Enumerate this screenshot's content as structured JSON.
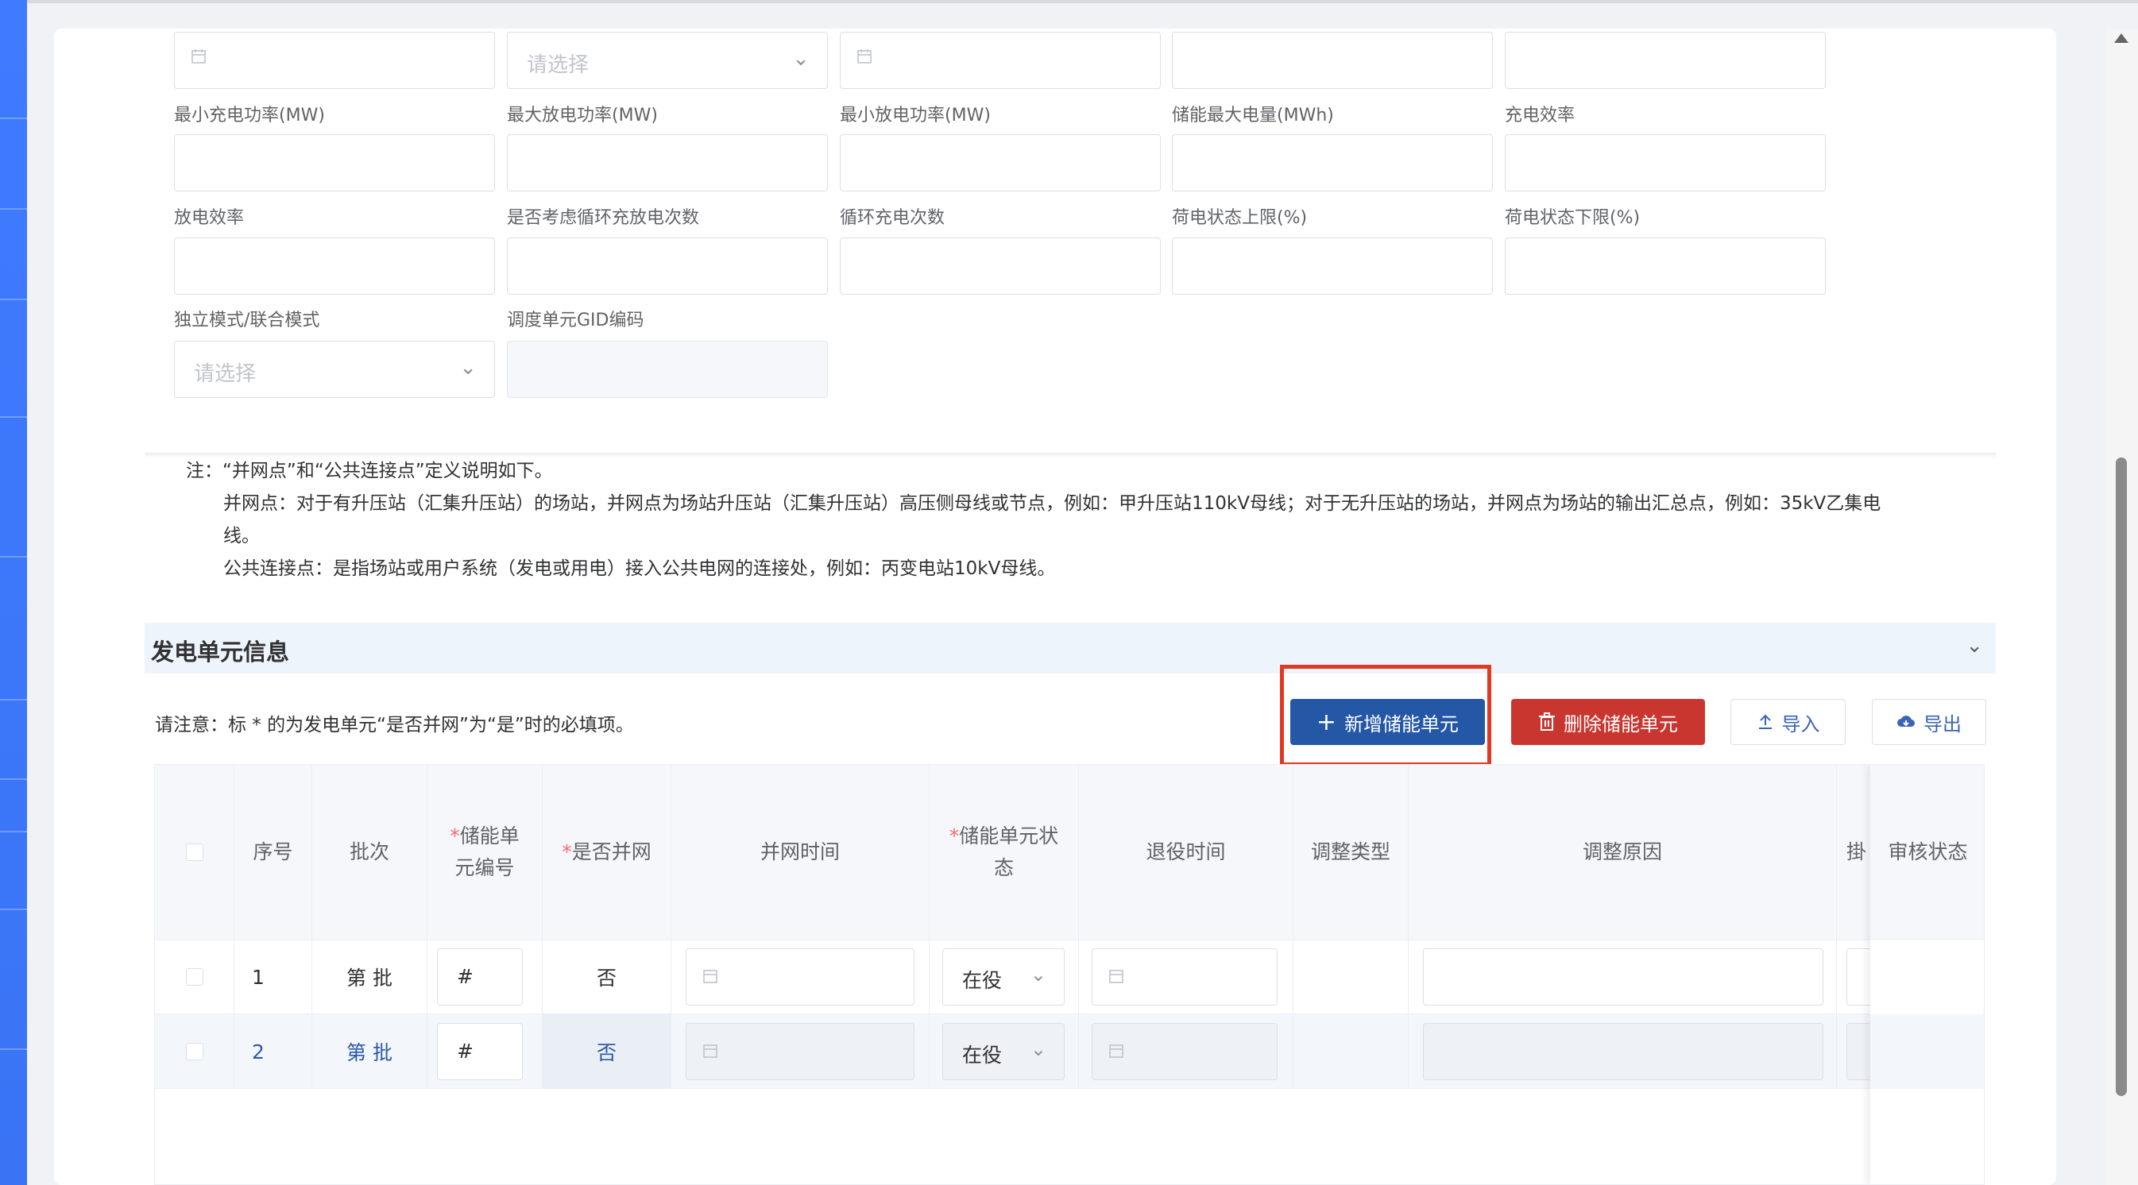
{
  "form": {
    "placeholder_select": "请选择",
    "labels": [
      "最小充电功率(MW)",
      "最大放电功率(MW)",
      "最小放电功率(MW)",
      "储能最大电量(MWh)",
      "充电效率",
      "放电效率",
      "是否考虑循环充放电次数",
      "循环充电次数",
      "荷电状态上限(%)",
      "荷电状态下限(%)",
      "独立模式/联合模式",
      "调度单元GID编码"
    ]
  },
  "note": {
    "line1": "注：“并网点”和“公共连接点”定义说明如下。",
    "line2": "并网点：对于有升压站（汇集升压站）的场站，并网点为场站升压站（汇集升压站）高压侧母线或节点，例如：甲升压站110kV母线；对于无升压站的场站，并网点为场站的输出汇总点，例如：35kV乙集电",
    "line3": "线。",
    "line4": "公共连接点：是指场站或用户系统（发电或用电）接入公共电网的连接处，例如：丙变电站10kV母线。"
  },
  "section": {
    "title": "发电单元信息",
    "hint": "请注意：标 * 的为发电单元“是否并网”为“是”时的必填项。"
  },
  "buttons": {
    "add": "新增储能单元",
    "delete": "删除储能单元",
    "import": "导入",
    "export": "导出"
  },
  "table": {
    "headers": {
      "index": "序号",
      "batch": "批次",
      "unit_no_1": "储能单",
      "unit_no_2": "元编号",
      "grid": "是否并网",
      "grid_time": "并网时间",
      "unit_status_1": "储能单元状",
      "unit_status_2": "态",
      "retire_time": "退役时间",
      "adjust_type": "调整类型",
      "adjust_reason": "调整原因",
      "partial": "掛",
      "audit": "审核状态"
    },
    "rows": [
      {
        "index": "1",
        "batch": "第 批",
        "unit_no": "#",
        "grid": "否",
        "status": "在役"
      },
      {
        "index": "2",
        "batch": "第 批",
        "unit_no": "#",
        "grid": "否",
        "status": "在役"
      }
    ]
  },
  "colors": {
    "primary": "#2557a7",
    "danger": "#c9362f",
    "highlight": "#e03a22",
    "section_bg": "#edf4fb"
  }
}
